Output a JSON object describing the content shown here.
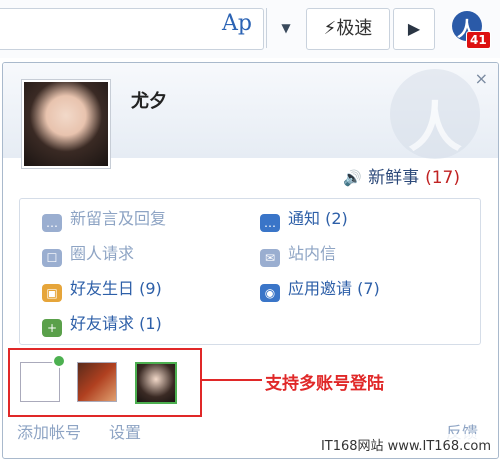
{
  "toolbar": {
    "reader_icon": "Ap",
    "speed_label": "极速",
    "notification_count": "41",
    "renren_glyph": "人"
  },
  "panel": {
    "close_glyph": "×",
    "username": "尤夕",
    "fresh_label": "新鲜事",
    "fresh_count": "(17)",
    "items": [
      {
        "label": "新留言及回复",
        "count": ""
      },
      {
        "label": "通知",
        "count": "(2)"
      },
      {
        "label": "圈人请求",
        "count": ""
      },
      {
        "label": "站内信",
        "count": ""
      },
      {
        "label": "好友生日",
        "count": "(9)"
      },
      {
        "label": "应用邀请",
        "count": "(7)"
      },
      {
        "label": "好友请求",
        "count": "(1)"
      }
    ],
    "annotation": "支持多账号登陆",
    "footer": {
      "add_account": "添加帐号",
      "settings": "设置",
      "feedback": "反馈"
    }
  },
  "watermark_text": "IT168网站 www.IT168.com",
  "colors": {
    "accent": "#2d5fa8",
    "annotation": "#e02828",
    "badge": "#d11111"
  }
}
